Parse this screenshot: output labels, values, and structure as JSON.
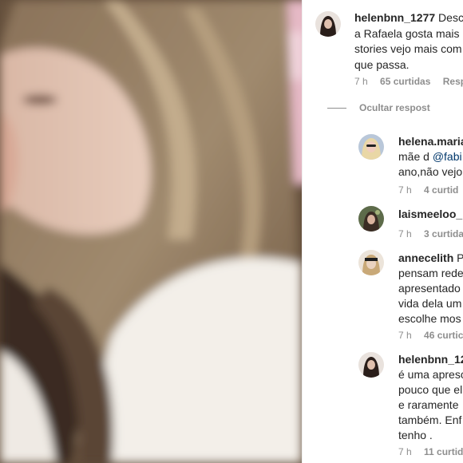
{
  "post": {
    "image_alt": "blurred photo of a woman with long light brown hair kissing another person"
  },
  "comments": {
    "main": {
      "username": "helenbnn_1277",
      "lines": [
        "Desc",
        "a Rafaela gosta mais",
        "stories vejo mais com",
        "que passa."
      ],
      "time": "7 h",
      "likes": "65 curtidas",
      "reply": "Resp"
    },
    "hide_replies": "Ocultar respost",
    "replies": [
      {
        "username": "helena.maria",
        "lines": [
          "",
          "mãe d",
          "ano,não vejo"
        ],
        "mention": "@fabi",
        "time": "7 h",
        "likes": "4 curtid"
      },
      {
        "username": "laismeeloo_",
        "lines": [
          ""
        ],
        "time": "7 h",
        "likes": "3 curtida"
      },
      {
        "username": "annecelith",
        "lines": [
          "P",
          "pensam rede",
          "apresentado",
          "vida dela um",
          "escolhe mos"
        ],
        "time": "7 h",
        "likes": "46 curtic"
      },
      {
        "username": "helenbnn_12",
        "lines": [
          "",
          "é uma apresc",
          "pouco que el",
          "e raramente",
          "também. Enf",
          "tenho ."
        ],
        "time": "7 h",
        "likes": "11 curtida"
      }
    ]
  }
}
